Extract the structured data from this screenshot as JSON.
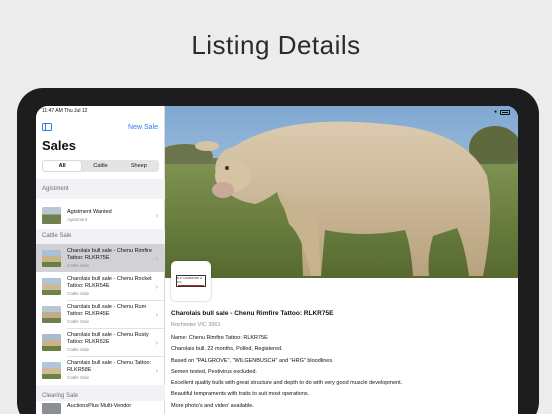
{
  "headline": "Listing Details",
  "status_bar": {
    "time_date": "11:47 AM  Thu Jul 12"
  },
  "sidebar": {
    "new_sale_label": "New Sale",
    "title": "Sales",
    "segments": [
      {
        "label": "All",
        "active": true
      },
      {
        "label": "Cattle",
        "active": false
      },
      {
        "label": "Sheep",
        "active": false
      }
    ],
    "sections": [
      {
        "header": "Agistment",
        "items": [
          {
            "title": "Agistment Wanted",
            "subtitle": "Agistment"
          }
        ]
      },
      {
        "header": "Cattle Sale",
        "items": [
          {
            "title": "Charolais bull sale - Chenu Rimfire Tattoo: RLKR75E",
            "subtitle": "Cattle Sale",
            "selected": true
          },
          {
            "title": "Charolais bull sale - Chenu Rocket Tattoo: RLKR54E",
            "subtitle": "Cattle Sale"
          },
          {
            "title": "Charolais bull sale - Chenu Rum Tattoo: RLKR45E",
            "subtitle": "Cattle Sale"
          },
          {
            "title": "Charolais bull sale - Chenu Rusty Tattoo: RLKR52E",
            "subtitle": "Cattle Sale"
          },
          {
            "title": "Charolais bull sale - Chenu Tattoo: RLKR58E",
            "subtitle": "Cattle Sale"
          }
        ]
      },
      {
        "header": "Clearing Sale",
        "items": [
          {
            "title": "AuctionsPlus Multi-Vendor",
            "subtitle": ""
          }
        ]
      }
    ]
  },
  "detail": {
    "logo_text": "R.P. HAMMOND & CO.",
    "title": "Charolais bull sale - Chenu Rimfire Tattoo: RLKR75E",
    "location": "Rochester VIC 3561",
    "lines": [
      "Name: Chenu Rimfire Tattoo: RLKR75E",
      "Charolais bull, 22 months, Polled, Registered.",
      "Based on \"PALGROVE\", \"WILGENBUSCH\" and \"HRG\" bloodlines.",
      "Semen tested, Pestivirus excluded.",
      "Excellent quality bulls with great structure and depth to do with very good muscle development.",
      "Beautiful tempraments with traits to suit most operations.",
      "More photo's and video' available."
    ]
  },
  "colors": {
    "accent": "#2b7de9",
    "selected_row": "#d1d1d6",
    "grouped_bg": "#f2f2f6"
  }
}
